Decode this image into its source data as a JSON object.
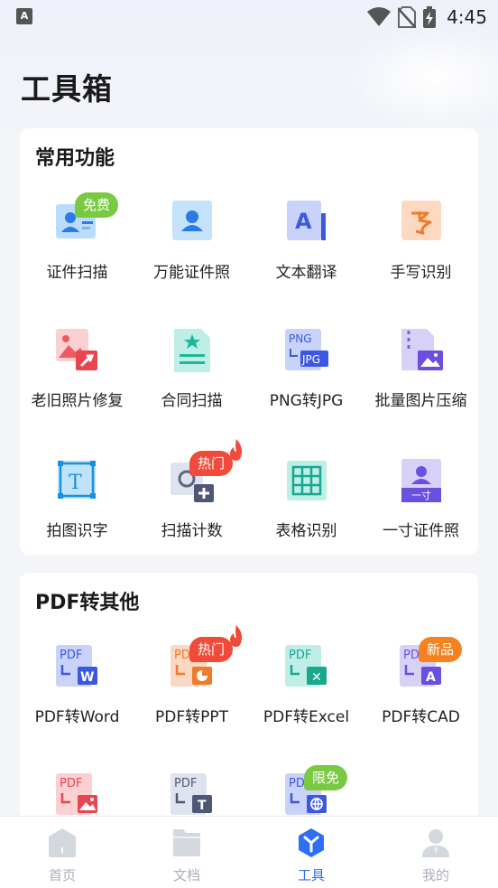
{
  "status_bar": {
    "app_icon_letter": "A",
    "time": "4:45"
  },
  "page_title": "工具箱",
  "common": {
    "title": "常用功能",
    "items": [
      {
        "label": "证件扫描",
        "badge": "免费"
      },
      {
        "label": "万能证件照"
      },
      {
        "label": "文本翻译",
        "icon_text": "A"
      },
      {
        "label": "手写识别"
      },
      {
        "label": "老旧照片修复"
      },
      {
        "label": "合同扫描"
      },
      {
        "label": "PNG转JPG",
        "icon_text_top": "PNG",
        "icon_text_bottom": "JPG"
      },
      {
        "label": "批量图片压缩"
      },
      {
        "label": "拍图识字",
        "icon_text": "T"
      },
      {
        "label": "扫描计数",
        "badge": "热门"
      },
      {
        "label": "表格识别"
      },
      {
        "label": "一寸证件照",
        "icon_text": "一寸"
      }
    ]
  },
  "pdf": {
    "title": "PDF转其他",
    "items": [
      {
        "label": "PDF转Word",
        "icon_text": "PDF",
        "sub_icon_text": "W"
      },
      {
        "label": "PDF转PPT",
        "icon_text": "PD",
        "badge": "热门"
      },
      {
        "label": "PDF转Excel",
        "icon_text": "PDF",
        "sub_icon_text": "✕"
      },
      {
        "label": "PDF转CAD",
        "icon_text": "PD",
        "sub_icon_text": "A",
        "badge": "新品"
      },
      {
        "icon_text": "PDF"
      },
      {
        "icon_text": "PDF",
        "sub_icon_text": "T"
      },
      {
        "icon_text": "PD",
        "badge": "限免"
      }
    ]
  },
  "nav": {
    "items": [
      {
        "label": "首页"
      },
      {
        "label": "文档"
      },
      {
        "label": "工具"
      },
      {
        "label": "我的"
      }
    ]
  },
  "colors": {
    "accent": "#2f6ff5",
    "badge_green": "#7ac943",
    "badge_red": "#f04b3a",
    "badge_orange": "#f5821f"
  }
}
